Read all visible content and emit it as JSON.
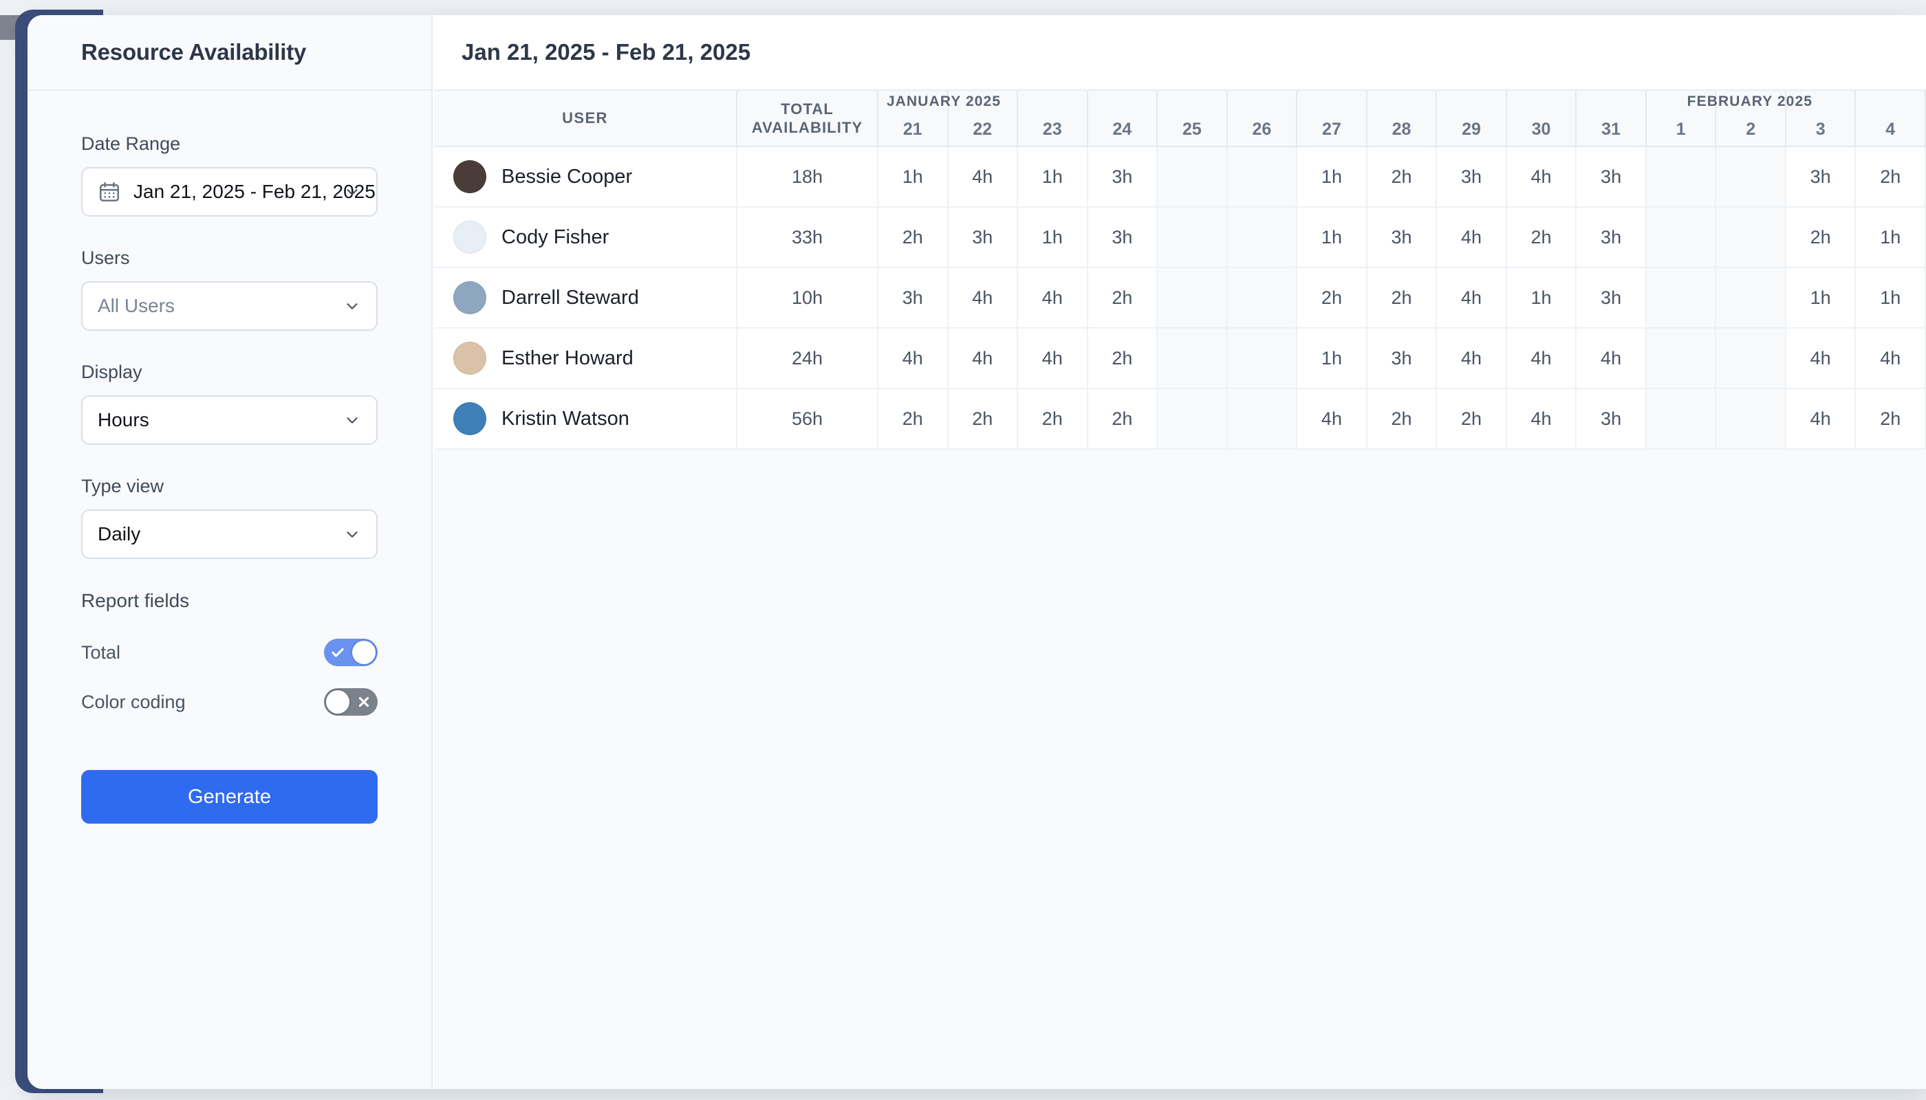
{
  "sidebar": {
    "title": "Resource Availability",
    "date_range": {
      "label": "Date Range",
      "value": "Jan 21, 2025 - Feb 21, 2025"
    },
    "users": {
      "label": "Users",
      "value": "All Users"
    },
    "display": {
      "label": "Display",
      "value": "Hours"
    },
    "type_view": {
      "label": "Type view",
      "value": "Daily"
    },
    "report_fields": {
      "title": "Report fields",
      "items": [
        {
          "label": "Total",
          "state": "on"
        },
        {
          "label": "Color coding",
          "state": "off"
        }
      ]
    },
    "generate_label": "Generate"
  },
  "main": {
    "title": "Jan 21, 2025 - Feb 21, 2025",
    "columns": {
      "user": "USER",
      "total_line1": "TOTAL",
      "total_line2": "AVAILABILITY"
    },
    "months": [
      {
        "name": "JANUARY 2025",
        "span": 11
      },
      {
        "name": "FEBRUARY 2025",
        "span": 4
      }
    ],
    "days": [
      "21",
      "22",
      "23",
      "24",
      "25",
      "26",
      "27",
      "28",
      "29",
      "30",
      "31",
      "1",
      "2",
      "3",
      "4"
    ],
    "weekend_index": [
      4,
      5,
      11,
      12
    ],
    "rows": [
      {
        "name": "Bessie Cooper",
        "total": "18h",
        "avatar": "#4a3c38",
        "values": [
          "1h",
          "4h",
          "1h",
          "3h",
          "",
          "",
          "1h",
          "2h",
          "3h",
          "4h",
          "3h",
          "",
          "",
          "3h",
          "2h"
        ]
      },
      {
        "name": "Cody Fisher",
        "total": "33h",
        "avatar": "#e8eef5",
        "values": [
          "2h",
          "3h",
          "1h",
          "3h",
          "",
          "",
          "1h",
          "3h",
          "4h",
          "2h",
          "3h",
          "",
          "",
          "2h",
          "1h"
        ]
      },
      {
        "name": "Darrell Steward",
        "total": "10h",
        "avatar": "#8fa6c0",
        "values": [
          "3h",
          "4h",
          "4h",
          "2h",
          "",
          "",
          "2h",
          "2h",
          "4h",
          "1h",
          "3h",
          "",
          "",
          "1h",
          "1h"
        ]
      },
      {
        "name": "Esther Howard",
        "total": "24h",
        "avatar": "#d9c2a8",
        "values": [
          "4h",
          "4h",
          "4h",
          "2h",
          "",
          "",
          "1h",
          "3h",
          "4h",
          "4h",
          "4h",
          "",
          "",
          "4h",
          "4h"
        ]
      },
      {
        "name": "Kristin Watson",
        "total": "56h",
        "avatar": "#3f7fb8",
        "values": [
          "2h",
          "2h",
          "2h",
          "2h",
          "",
          "",
          "4h",
          "2h",
          "2h",
          "4h",
          "3h",
          "",
          "",
          "4h",
          "2h"
        ]
      }
    ]
  },
  "colors": {
    "accent": "#2f6bf0",
    "toggle_on": "#6a93ef",
    "toggle_off": "#7b828c",
    "nav_rail": "#3c4f7c",
    "title_text": "#2d3748"
  },
  "icons": {
    "calendar": "calendar-icon",
    "chevron": "chevron-down-icon",
    "check": "check-icon",
    "cross": "cross-icon"
  }
}
